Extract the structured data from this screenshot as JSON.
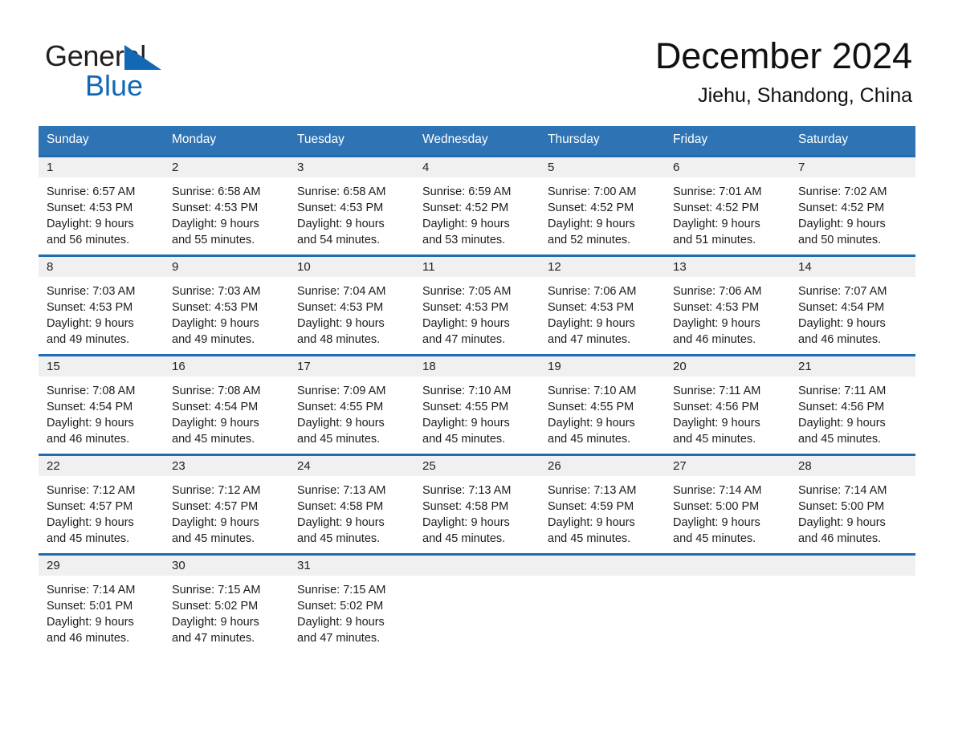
{
  "logo": {
    "word_one": "General",
    "word_two": "Blue",
    "triangle_color": "#1268b3"
  },
  "header": {
    "month_title": "December 2024",
    "location": "Jiehu, Shandong, China"
  },
  "theme": {
    "header_blue": "#2e74b5",
    "rule_blue": "#1f6cb0",
    "date_band_gray": "#f0f0f0",
    "text_dark": "#1c1c1c"
  },
  "weekday_headers": [
    "Sunday",
    "Monday",
    "Tuesday",
    "Wednesday",
    "Thursday",
    "Friday",
    "Saturday"
  ],
  "weeks": [
    {
      "days": [
        {
          "date": "1",
          "sunrise": "Sunrise: 6:57 AM",
          "sunset": "Sunset: 4:53 PM",
          "daylight_1": "Daylight: 9 hours",
          "daylight_2": "and 56 minutes."
        },
        {
          "date": "2",
          "sunrise": "Sunrise: 6:58 AM",
          "sunset": "Sunset: 4:53 PM",
          "daylight_1": "Daylight: 9 hours",
          "daylight_2": "and 55 minutes."
        },
        {
          "date": "3",
          "sunrise": "Sunrise: 6:58 AM",
          "sunset": "Sunset: 4:53 PM",
          "daylight_1": "Daylight: 9 hours",
          "daylight_2": "and 54 minutes."
        },
        {
          "date": "4",
          "sunrise": "Sunrise: 6:59 AM",
          "sunset": "Sunset: 4:52 PM",
          "daylight_1": "Daylight: 9 hours",
          "daylight_2": "and 53 minutes."
        },
        {
          "date": "5",
          "sunrise": "Sunrise: 7:00 AM",
          "sunset": "Sunset: 4:52 PM",
          "daylight_1": "Daylight: 9 hours",
          "daylight_2": "and 52 minutes."
        },
        {
          "date": "6",
          "sunrise": "Sunrise: 7:01 AM",
          "sunset": "Sunset: 4:52 PM",
          "daylight_1": "Daylight: 9 hours",
          "daylight_2": "and 51 minutes."
        },
        {
          "date": "7",
          "sunrise": "Sunrise: 7:02 AM",
          "sunset": "Sunset: 4:52 PM",
          "daylight_1": "Daylight: 9 hours",
          "daylight_2": "and 50 minutes."
        }
      ]
    },
    {
      "days": [
        {
          "date": "8",
          "sunrise": "Sunrise: 7:03 AM",
          "sunset": "Sunset: 4:53 PM",
          "daylight_1": "Daylight: 9 hours",
          "daylight_2": "and 49 minutes."
        },
        {
          "date": "9",
          "sunrise": "Sunrise: 7:03 AM",
          "sunset": "Sunset: 4:53 PM",
          "daylight_1": "Daylight: 9 hours",
          "daylight_2": "and 49 minutes."
        },
        {
          "date": "10",
          "sunrise": "Sunrise: 7:04 AM",
          "sunset": "Sunset: 4:53 PM",
          "daylight_1": "Daylight: 9 hours",
          "daylight_2": "and 48 minutes."
        },
        {
          "date": "11",
          "sunrise": "Sunrise: 7:05 AM",
          "sunset": "Sunset: 4:53 PM",
          "daylight_1": "Daylight: 9 hours",
          "daylight_2": "and 47 minutes."
        },
        {
          "date": "12",
          "sunrise": "Sunrise: 7:06 AM",
          "sunset": "Sunset: 4:53 PM",
          "daylight_1": "Daylight: 9 hours",
          "daylight_2": "and 47 minutes."
        },
        {
          "date": "13",
          "sunrise": "Sunrise: 7:06 AM",
          "sunset": "Sunset: 4:53 PM",
          "daylight_1": "Daylight: 9 hours",
          "daylight_2": "and 46 minutes."
        },
        {
          "date": "14",
          "sunrise": "Sunrise: 7:07 AM",
          "sunset": "Sunset: 4:54 PM",
          "daylight_1": "Daylight: 9 hours",
          "daylight_2": "and 46 minutes."
        }
      ]
    },
    {
      "days": [
        {
          "date": "15",
          "sunrise": "Sunrise: 7:08 AM",
          "sunset": "Sunset: 4:54 PM",
          "daylight_1": "Daylight: 9 hours",
          "daylight_2": "and 46 minutes."
        },
        {
          "date": "16",
          "sunrise": "Sunrise: 7:08 AM",
          "sunset": "Sunset: 4:54 PM",
          "daylight_1": "Daylight: 9 hours",
          "daylight_2": "and 45 minutes."
        },
        {
          "date": "17",
          "sunrise": "Sunrise: 7:09 AM",
          "sunset": "Sunset: 4:55 PM",
          "daylight_1": "Daylight: 9 hours",
          "daylight_2": "and 45 minutes."
        },
        {
          "date": "18",
          "sunrise": "Sunrise: 7:10 AM",
          "sunset": "Sunset: 4:55 PM",
          "daylight_1": "Daylight: 9 hours",
          "daylight_2": "and 45 minutes."
        },
        {
          "date": "19",
          "sunrise": "Sunrise: 7:10 AM",
          "sunset": "Sunset: 4:55 PM",
          "daylight_1": "Daylight: 9 hours",
          "daylight_2": "and 45 minutes."
        },
        {
          "date": "20",
          "sunrise": "Sunrise: 7:11 AM",
          "sunset": "Sunset: 4:56 PM",
          "daylight_1": "Daylight: 9 hours",
          "daylight_2": "and 45 minutes."
        },
        {
          "date": "21",
          "sunrise": "Sunrise: 7:11 AM",
          "sunset": "Sunset: 4:56 PM",
          "daylight_1": "Daylight: 9 hours",
          "daylight_2": "and 45 minutes."
        }
      ]
    },
    {
      "days": [
        {
          "date": "22",
          "sunrise": "Sunrise: 7:12 AM",
          "sunset": "Sunset: 4:57 PM",
          "daylight_1": "Daylight: 9 hours",
          "daylight_2": "and 45 minutes."
        },
        {
          "date": "23",
          "sunrise": "Sunrise: 7:12 AM",
          "sunset": "Sunset: 4:57 PM",
          "daylight_1": "Daylight: 9 hours",
          "daylight_2": "and 45 minutes."
        },
        {
          "date": "24",
          "sunrise": "Sunrise: 7:13 AM",
          "sunset": "Sunset: 4:58 PM",
          "daylight_1": "Daylight: 9 hours",
          "daylight_2": "and 45 minutes."
        },
        {
          "date": "25",
          "sunrise": "Sunrise: 7:13 AM",
          "sunset": "Sunset: 4:58 PM",
          "daylight_1": "Daylight: 9 hours",
          "daylight_2": "and 45 minutes."
        },
        {
          "date": "26",
          "sunrise": "Sunrise: 7:13 AM",
          "sunset": "Sunset: 4:59 PM",
          "daylight_1": "Daylight: 9 hours",
          "daylight_2": "and 45 minutes."
        },
        {
          "date": "27",
          "sunrise": "Sunrise: 7:14 AM",
          "sunset": "Sunset: 5:00 PM",
          "daylight_1": "Daylight: 9 hours",
          "daylight_2": "and 45 minutes."
        },
        {
          "date": "28",
          "sunrise": "Sunrise: 7:14 AM",
          "sunset": "Sunset: 5:00 PM",
          "daylight_1": "Daylight: 9 hours",
          "daylight_2": "and 46 minutes."
        }
      ]
    },
    {
      "days": [
        {
          "date": "29",
          "sunrise": "Sunrise: 7:14 AM",
          "sunset": "Sunset: 5:01 PM",
          "daylight_1": "Daylight: 9 hours",
          "daylight_2": "and 46 minutes."
        },
        {
          "date": "30",
          "sunrise": "Sunrise: 7:15 AM",
          "sunset": "Sunset: 5:02 PM",
          "daylight_1": "Daylight: 9 hours",
          "daylight_2": "and 47 minutes."
        },
        {
          "date": "31",
          "sunrise": "Sunrise: 7:15 AM",
          "sunset": "Sunset: 5:02 PM",
          "daylight_1": "Daylight: 9 hours",
          "daylight_2": "and 47 minutes."
        },
        {
          "date": "",
          "sunrise": "",
          "sunset": "",
          "daylight_1": "",
          "daylight_2": ""
        },
        {
          "date": "",
          "sunrise": "",
          "sunset": "",
          "daylight_1": "",
          "daylight_2": ""
        },
        {
          "date": "",
          "sunrise": "",
          "sunset": "",
          "daylight_1": "",
          "daylight_2": ""
        },
        {
          "date": "",
          "sunrise": "",
          "sunset": "",
          "daylight_1": "",
          "daylight_2": ""
        }
      ]
    }
  ]
}
